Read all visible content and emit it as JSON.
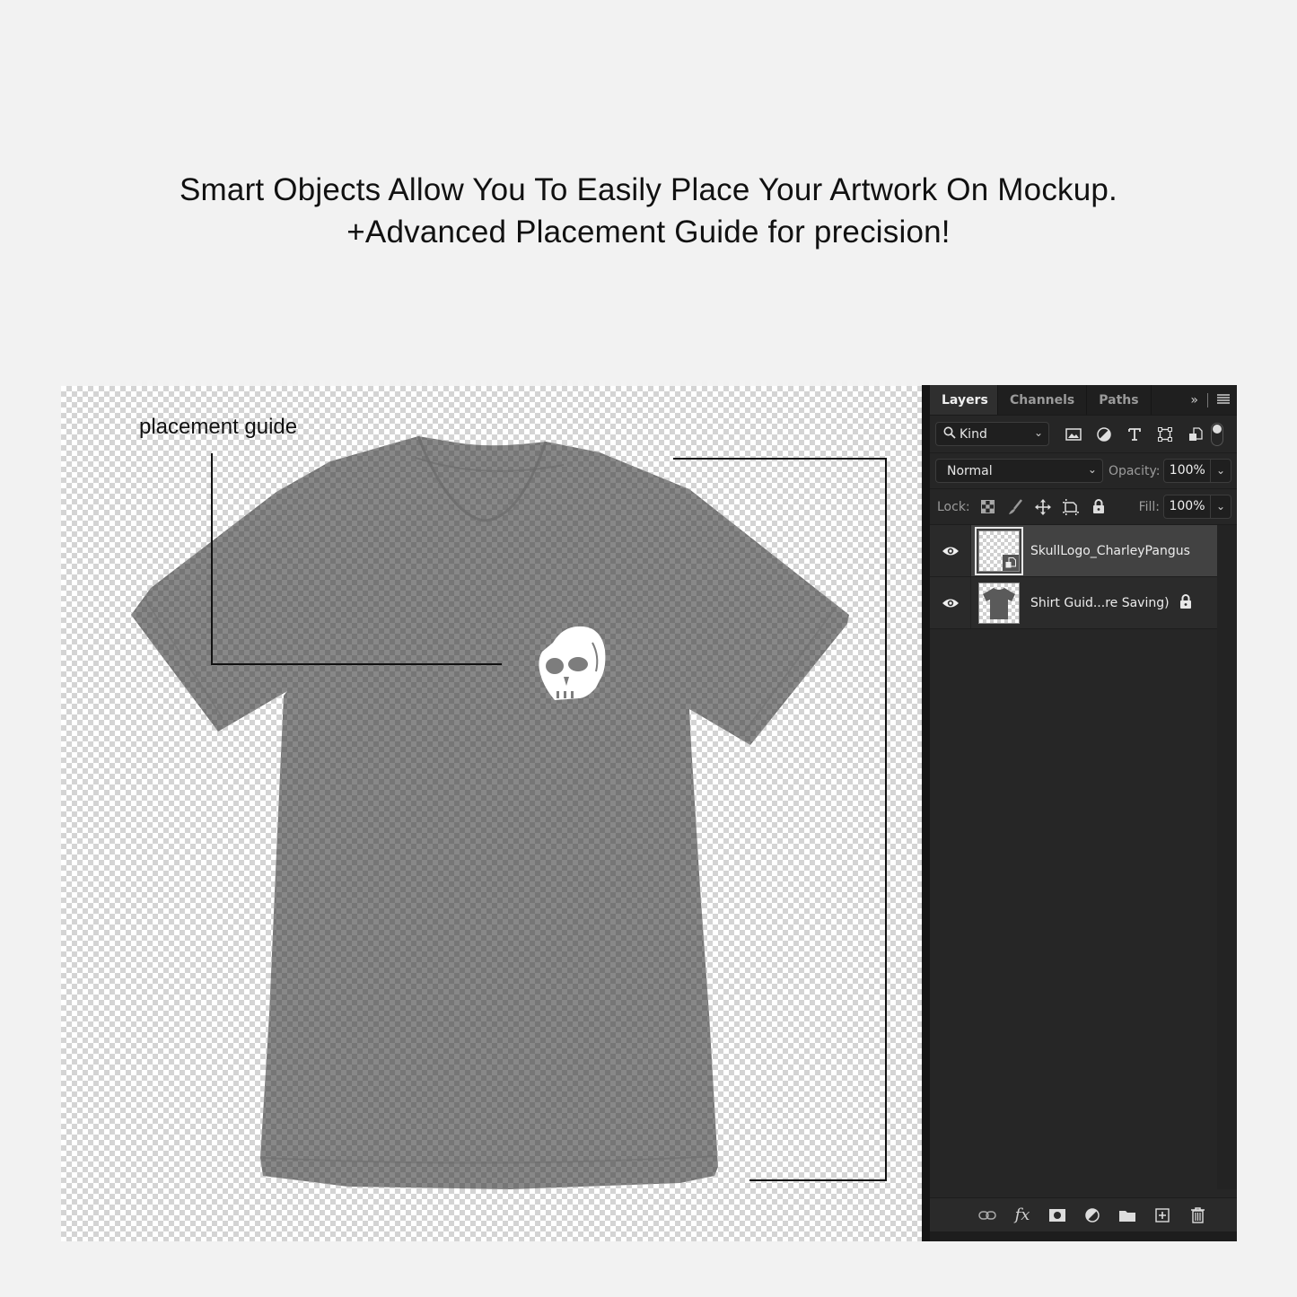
{
  "headline": {
    "line1": "Smart Objects Allow You To Easily Place Your Artwork On Mockup.",
    "line2": "+Advanced Placement Guide for precision!"
  },
  "canvas": {
    "guide_label": "placement guide",
    "shirt_color": "#7d7d7d",
    "artwork": "skull-logo"
  },
  "panel": {
    "tabs": [
      {
        "label": "Layers",
        "active": true
      },
      {
        "label": "Channels",
        "active": false
      },
      {
        "label": "Paths",
        "active": false
      }
    ],
    "filter": {
      "kind_label": "Kind",
      "icons": [
        "image-filter-icon",
        "adjustment-filter-icon",
        "type-filter-icon",
        "shape-filter-icon",
        "smart-object-filter-icon"
      ]
    },
    "blend_mode": "Normal",
    "opacity_label": "Opacity:",
    "opacity_value": "100%",
    "lock_label": "Lock:",
    "fill_label": "Fill:",
    "fill_value": "100%",
    "layers": [
      {
        "name": "SkullLogo_CharleyPangus",
        "visible": true,
        "selected": true,
        "smart_object": true,
        "locked": false
      },
      {
        "name": "Shirt Guid...re Saving)",
        "visible": true,
        "selected": false,
        "smart_object": false,
        "locked": true
      }
    ],
    "footer_icons": [
      "link-layers-icon",
      "fx-icon",
      "layer-mask-icon",
      "adjustment-layer-icon",
      "group-folder-icon",
      "new-layer-icon",
      "trash-icon"
    ]
  },
  "colors": {
    "panel_bg": "#262626",
    "selected_layer": "#424242",
    "page_bg": "#f2f2f2"
  }
}
